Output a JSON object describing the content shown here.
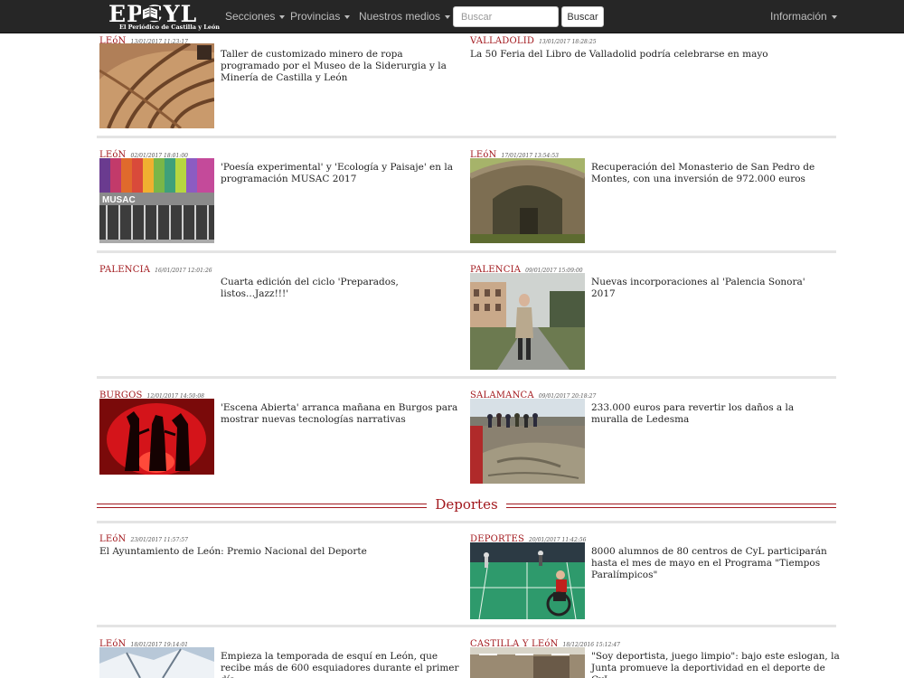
{
  "nav": {
    "logo_text": "EPCYL",
    "logo_sub": "El Periódico de Castilla y León",
    "items": [
      "Secciones",
      "Provincias",
      "Nuestros medios"
    ],
    "search_placeholder": "Buscar",
    "search_button": "Buscar",
    "info": "Información"
  },
  "articles": [
    {
      "region": "LEóN",
      "date": "13/01/2017 11:23:17",
      "title": "Taller de customizado minero de ropa programado por el Museo de la Siderurgia y la Minería de Castilla y León"
    },
    {
      "region": "VALLADOLID",
      "date": "13/01/2017 18:28:25",
      "title": "La 50 Feria del Libro de Valladolid podría celebrarse en mayo"
    },
    {
      "region": "LEóN",
      "date": "02/01/2017 18:01:00",
      "title": "'Poesía experimental' y 'Ecología y Paisaje' en la programación MUSAC 2017"
    },
    {
      "region": "LEóN",
      "date": "17/01/2017 13:54:53",
      "title": "Recuperación del Monasterio de San Pedro de Montes, con una inversión de 972.000 euros"
    },
    {
      "region": "PALENCIA",
      "date": "16/01/2017 12:01:26",
      "title": "Cuarta edición del ciclo 'Preparados, listos...Jazz!!!'"
    },
    {
      "region": "PALENCIA",
      "date": "09/01/2017 15:09:00",
      "title": "Nuevas incorporaciones al 'Palencia Sonora' 2017"
    },
    {
      "region": "BURGOS",
      "date": "12/01/2017 14:50:08",
      "title": "'Escena Abierta' arranca mañana en Burgos para mostrar nuevas tecnologías narrativas"
    },
    {
      "region": "SALAMANCA",
      "date": "09/01/2017 20:18:27",
      "title": "233.000 euros para revertir los daños a la muralla de Ledesma"
    },
    {
      "region": "LEóN",
      "date": "23/01/2017 11:57:57",
      "title": "El Ayuntamiento de León: Premio Nacional del Deporte"
    },
    {
      "region": "DEPORTES",
      "date": "20/01/2017 11:42:56",
      "title": "8000 alumnos de 80 centros de CyL participarán hasta el mes de mayo en el Programa \"Tiempos Paralímpicos\""
    },
    {
      "region": "LEóN",
      "date": "18/01/2017 19:14:01",
      "title": "Empieza la temporada de esquí en León, que recibe más de 600 esquiadores durante el primer día"
    },
    {
      "region": "CASTILLA Y LEóN",
      "date": "18/12/2016 15:12:47",
      "title": "\"Soy deportista, juego limpio\": bajo este eslogan, la Junta promueve la deportividad en el deporte de CyL"
    }
  ],
  "section": {
    "title": "Deportes"
  },
  "colors": {
    "accent": "#a2181d",
    "navbar": "#262626"
  }
}
